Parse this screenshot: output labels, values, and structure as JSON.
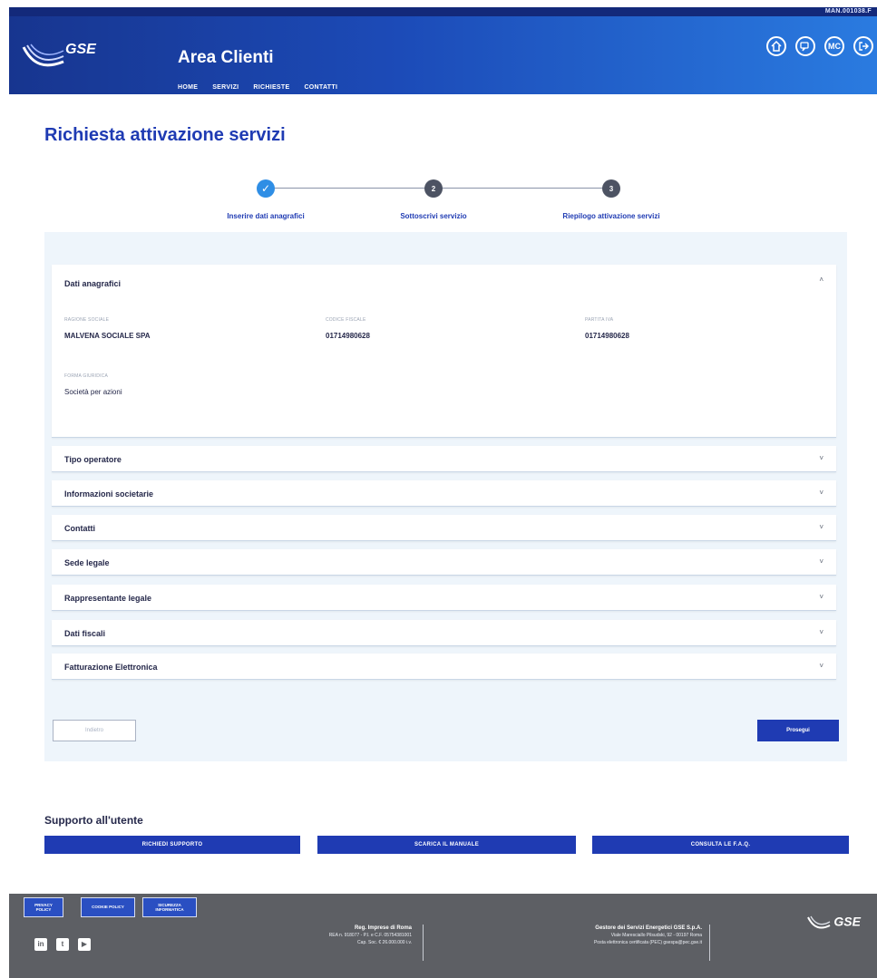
{
  "header": {
    "user_tag": "MAN.001038.F",
    "logo_text": "GSE",
    "app_title": "Area Clienti",
    "nav": [
      "HOME",
      "SERVIZI",
      "RICHIESTE",
      "CONTATTI"
    ],
    "icons": [
      "home-icon",
      "chat-icon",
      "mc-icon",
      "logout-icon"
    ],
    "mc_label": "MC"
  },
  "page_title": "Richiesta attivazione servizi",
  "stepper": {
    "steps": [
      {
        "label": "Inserire dati anagrafici",
        "state": "done",
        "number": "1"
      },
      {
        "label": "Sottoscrivi servizio",
        "state": "pending",
        "number": "2"
      },
      {
        "label": "Riepilogo attivazione servizi",
        "state": "pending",
        "number": "3"
      }
    ]
  },
  "dati_anagrafici": {
    "title": "Dati anagrafici",
    "fields": [
      {
        "label": "RAGIONE SOCIALE",
        "value": "MALVENA SOCIALE SPA"
      },
      {
        "label": "CODICE FISCALE",
        "value": "01714980628"
      },
      {
        "label": "PARTITA IVA",
        "value": "01714980628"
      },
      {
        "label": "FORMA GIURIDICA",
        "value": "Società per azioni"
      }
    ]
  },
  "sections": [
    "Tipo operatore",
    "Informazioni societarie",
    "Contatti",
    "Sede legale",
    "Rappresentante legale",
    "Dati fiscali",
    "Fatturazione Elettronica"
  ],
  "buttons": {
    "back": "Indietro",
    "next": "Prosegui"
  },
  "support": {
    "title": "Supporto all'utente",
    "buttons": [
      "RICHIEDI SUPPORTO",
      "SCARICA IL MANUALE",
      "CONSULTA LE F.A.Q."
    ]
  },
  "footer": {
    "tags": [
      "PRIVACY POLICY",
      "COOKIE POLICY",
      "SICUREZZA INFORMATICA"
    ],
    "socials": [
      "linkedin-icon",
      "twitter-icon",
      "youtube-icon"
    ],
    "registry": {
      "title": "Reg. Imprese di Roma",
      "line1": "REA n. 918077 - P.I. e C.F. 05754381001",
      "line2": "Cap. Soc. € 26.000.000 i.v."
    },
    "company": {
      "title": "Gestore dei Servizi Energetici GSE S.p.A.",
      "line1": "Viale Maresciallo Pilsudski, 92 - 00197 Roma",
      "line2": "Posta elettronica certificata (PEC) gsespa@pec.gse.it"
    },
    "logo_text": "GSE"
  }
}
